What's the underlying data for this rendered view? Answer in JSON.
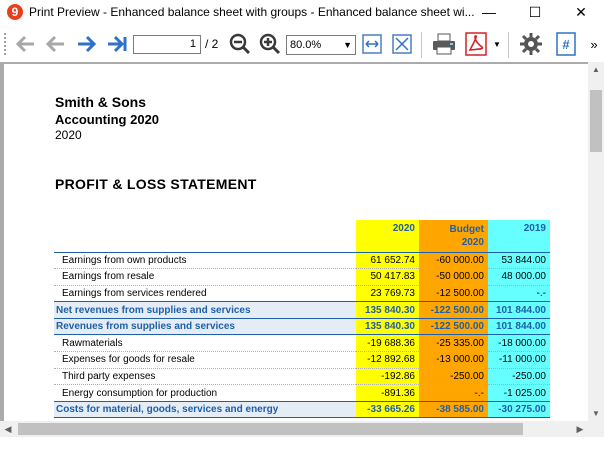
{
  "window": {
    "title": "Print Preview - Enhanced balance sheet with groups - Enhanced balance sheet wi...",
    "app_icon_glyph": "9",
    "minimize_glyph": "—",
    "maximize_glyph": "☐",
    "close_glyph": "✕"
  },
  "toolbar": {
    "current_page": "1",
    "total_pages": "/ 2",
    "zoom": "80.0%",
    "more_glyph": "»",
    "icons": [
      "first-page-icon",
      "previous-page-icon",
      "next-page-icon",
      "last-page-icon",
      "zoom-out-icon",
      "zoom-in-icon",
      "fit-width-icon",
      "fit-page-icon",
      "print-icon",
      "pdf-icon",
      "settings-icon",
      "page-number-icon"
    ]
  },
  "report": {
    "company": "Smith & Sons",
    "subtitle": "Accounting 2020",
    "year": "2020",
    "title": "PROFIT & LOSS STATEMENT",
    "columns": {
      "c2020": "2020",
      "budget": "Budget\n2020",
      "c2019": "2019"
    },
    "rows": [
      {
        "type": "detail",
        "label": "Earnings from own products",
        "v2020": "61 652.74",
        "budget": "-60 000.00",
        "v2019": "53 844.00"
      },
      {
        "type": "detail",
        "label": "Earnings from resale",
        "v2020": "50 417.83",
        "budget": "-50 000.00",
        "v2019": "48 000.00"
      },
      {
        "type": "detail",
        "label": "Earnings from services rendered",
        "v2020": "23 769.73",
        "budget": "-12 500.00",
        "v2019": "-.-"
      },
      {
        "type": "total",
        "label": "Net revenues from supplies and services",
        "v2020": "135 840.30",
        "budget": "-122 500.00",
        "v2019": "101 844.00"
      },
      {
        "type": "total",
        "label": "Revenues from supplies and services",
        "v2020": "135 840.30",
        "budget": "-122 500.00",
        "v2019": "101 844.00"
      },
      {
        "type": "detail",
        "label": "Rawmaterials",
        "v2020": "-19 688.36",
        "budget": "-25 335.00",
        "v2019": "-18 000.00"
      },
      {
        "type": "detail",
        "label": "Expenses for goods for resale",
        "v2020": "-12 892.68",
        "budget": "-13 000.00",
        "v2019": "-11 000.00"
      },
      {
        "type": "detail",
        "label": "Third party expenses",
        "v2020": "-192.86",
        "budget": "-250.00",
        "v2019": "-250.00"
      },
      {
        "type": "detail",
        "label": "Energy consumption for production",
        "v2020": "-891.36",
        "budget": "-.-",
        "v2019": "-1 025.00"
      },
      {
        "type": "total",
        "label": "Costs for material, goods, services and energy",
        "v2020": "-33 665.26",
        "budget": "-38 585.00",
        "v2019": "-30 275.00"
      }
    ]
  },
  "colors": {
    "col2020": "#ffff00",
    "budget": "#ffa500",
    "col2019": "#66ffff",
    "accent_blue": "#1f5fa8"
  }
}
